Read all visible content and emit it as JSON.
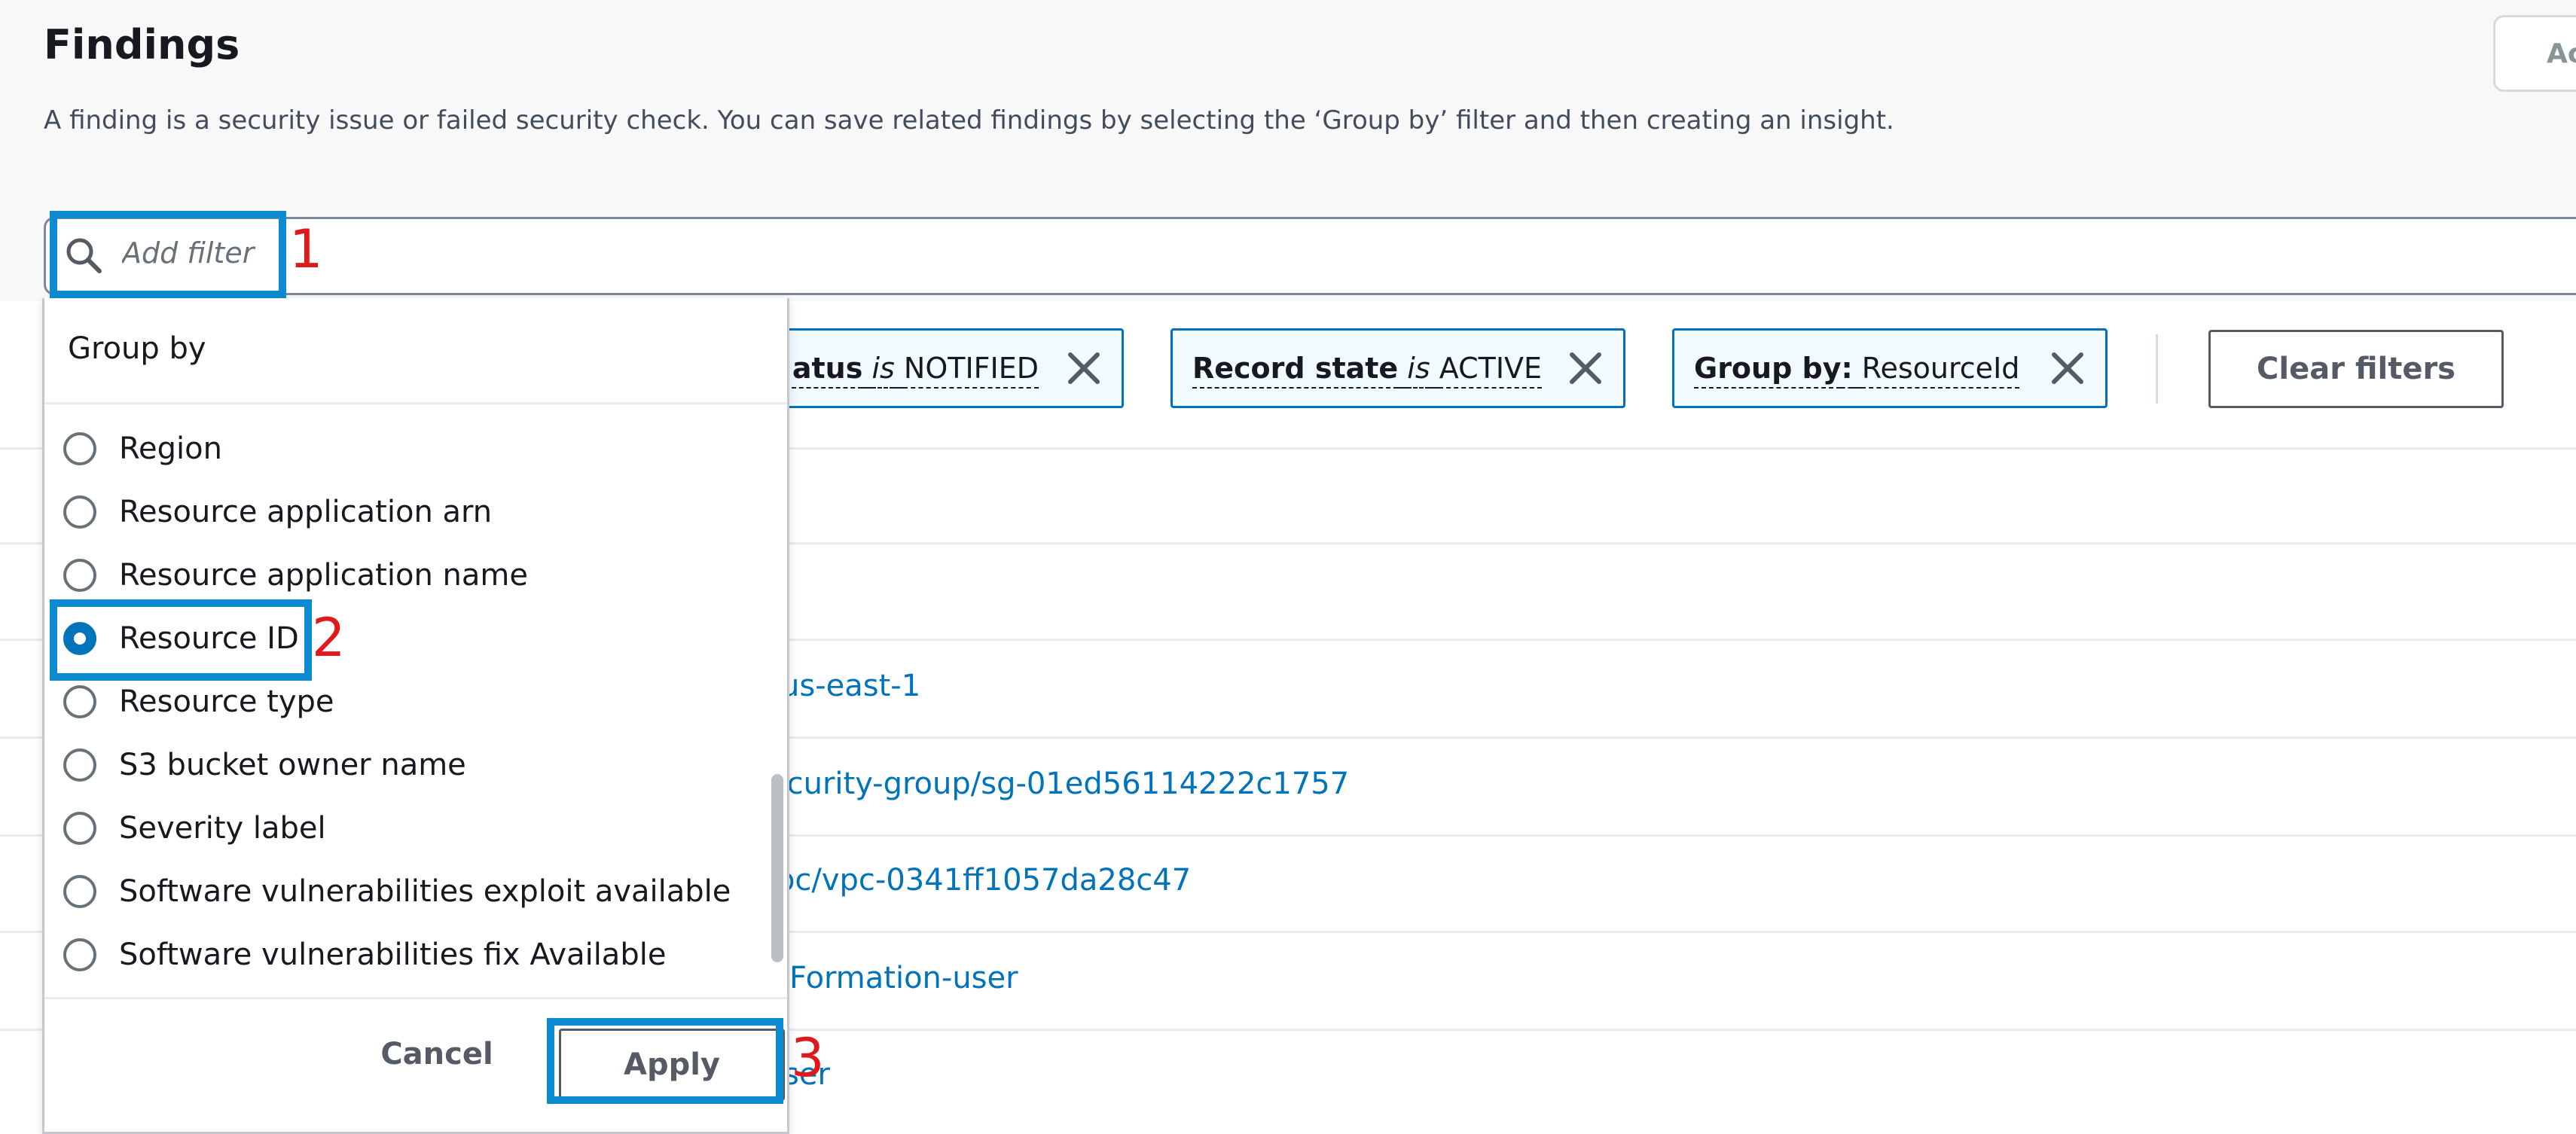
{
  "page": {
    "title": "Findings",
    "description": "A finding is a security issue or failed security check. You can save related findings by selecting the ‘Group by’ filter and then creating an insight.",
    "top_button_label": "Ac"
  },
  "filter_bar": {
    "placeholder": "Add filter",
    "search_icon": "search-icon"
  },
  "chips": [
    {
      "key": "atus",
      "op": "is",
      "value": "NOTIFIED"
    },
    {
      "key": "Record state",
      "op": "is",
      "value": "ACTIVE"
    },
    {
      "key": "Group by",
      "sep": ":",
      "value": "ResourceId"
    }
  ],
  "clear_filters_label": "Clear filters",
  "dropdown": {
    "header": "Group by",
    "options": [
      {
        "label": "Region",
        "checked": false
      },
      {
        "label": "Resource application arn",
        "checked": false
      },
      {
        "label": "Resource application name",
        "checked": false
      },
      {
        "label": "Resource ID",
        "checked": true
      },
      {
        "label": "Resource type",
        "checked": false
      },
      {
        "label": "S3 bucket owner name",
        "checked": false
      },
      {
        "label": "Severity label",
        "checked": false
      },
      {
        "label": "Software vulnerabilities exploit available",
        "checked": false
      },
      {
        "label": "Software vulnerabilities fix Available",
        "checked": false
      }
    ],
    "cancel_label": "Cancel",
    "apply_label": "Apply"
  },
  "table_rows_visible": [
    "us-east-1",
    "ecurity-group/sg-01ed56114222c1757",
    "pc/vpc-0341ff1057da28c47",
    "Formation-user",
    "ser"
  ],
  "annotations": {
    "step1": "1",
    "step2": "2",
    "step3": "3"
  },
  "colors": {
    "annotation_box": "#0d8bd1",
    "annotation_number": "#e0191c",
    "link": "#0073bb",
    "chip_border": "#0073bb"
  }
}
